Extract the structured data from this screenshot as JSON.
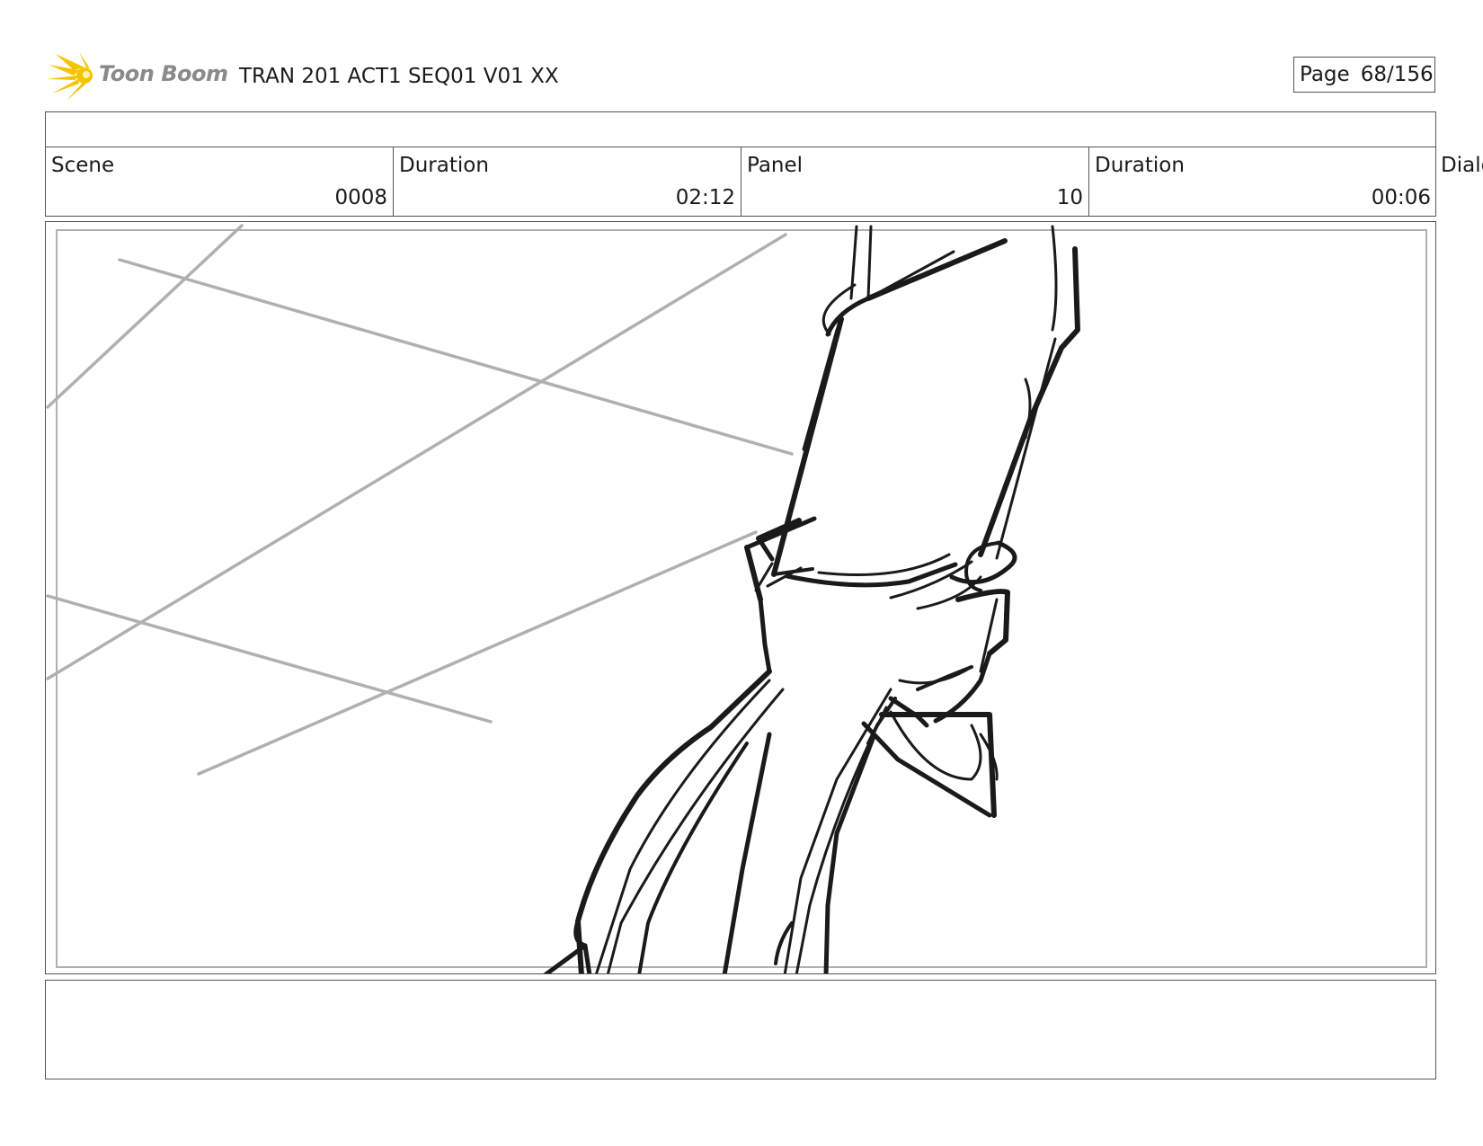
{
  "header": {
    "logo_text": "Toon Boom",
    "project_title": "TRAN 201 ACT1 SEQ01 V01 XX",
    "page_label": "Page",
    "page_number": "68/156"
  },
  "info": {
    "scene_label": "Scene",
    "scene_value": "0008",
    "scene_duration_label": "Duration",
    "scene_duration_value": "02:12",
    "panel_label": "Panel",
    "panel_value": "10",
    "panel_duration_label": "Duration",
    "panel_duration_value": "00:06",
    "dialog_label": "Dialo"
  },
  "colors": {
    "logo_star": "#f5c400",
    "logo_text": "#8a8a8a",
    "guide_lines": "#b0b0b0",
    "sketch_lines": "#1a1a1a",
    "frame_border": "#555555"
  },
  "icons": {
    "logo": "toon-boom-star-icon"
  }
}
